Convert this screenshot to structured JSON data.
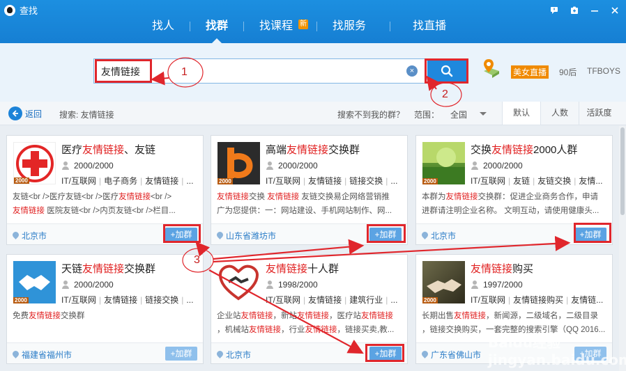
{
  "window": {
    "title": "查找",
    "controls": [
      "feedback-icon",
      "skin-icon",
      "minimize-icon",
      "close-icon"
    ]
  },
  "nav": {
    "items": [
      {
        "label": "找人"
      },
      {
        "label": "找群",
        "active": true
      },
      {
        "label": "找课程",
        "badge": "新"
      },
      {
        "label": "找服务"
      },
      {
        "label": "找直播"
      }
    ]
  },
  "search": {
    "value": "友情链接",
    "clear_icon": "×",
    "hot_live": "美女直播",
    "hot_words": [
      "90后",
      "TFBOYS"
    ]
  },
  "filter": {
    "back_label": "返回",
    "search_label": "搜索: 友情链接",
    "not_found": "搜索不到我的群？",
    "range_label": "范围：",
    "range_value": "全国",
    "sort_tabs": [
      "默认",
      "人数",
      "活跃度"
    ]
  },
  "cards": [
    {
      "name_parts": [
        "医疗",
        "友情链接",
        "、友链"
      ],
      "count": "2000/2000",
      "tags": [
        "IT/互联网",
        "电子商务",
        "友情链接",
        "..."
      ],
      "desc_line1": "友链<br />医疗友链<br />医疗友情链接<br />",
      "desc_line2": "友情链接 医院友链<br />内页友链<br />栏目...",
      "city": "北京市",
      "join": "+加群",
      "img_badge": "2000"
    },
    {
      "name_parts": [
        "高端",
        "友情链接",
        "交换群"
      ],
      "count": "2000/2000",
      "tags": [
        "IT/互联网",
        "友情链接",
        "链接交换",
        "..."
      ],
      "desc_line1": "友情链接交换 友情链接 友链交换易企网络营销推",
      "desc_line2": "广为您提供：一：网站建设、手机网站制作、网...",
      "city": "山东省潍坊市",
      "join": "+加群",
      "img_badge": "2000"
    },
    {
      "name_parts": [
        "交换",
        "友情链接",
        "2000人群"
      ],
      "count": "2000/2000",
      "tags": [
        "IT/互联网",
        "友链",
        "友链交换",
        "友情..."
      ],
      "desc_line1": "本群为友情链接交换群：促进企业商务合作，申请",
      "desc_line2": "进群请注明企业名称。 文明互动，请使用健康头...",
      "city": "北京市",
      "join": "+加群",
      "img_badge": "2000"
    },
    {
      "name_parts": [
        "天链",
        "友情链接",
        "交换群"
      ],
      "count": "2000/2000",
      "tags": [
        "IT/互联网",
        "友情链接",
        "链接交换",
        "..."
      ],
      "desc_line1": "免费友情链接交换群",
      "desc_line2": "",
      "city": "福建省福州市",
      "join": "+加群",
      "img_badge": "2000"
    },
    {
      "name_parts": [
        "",
        "友情链接",
        "十人群"
      ],
      "count": "1998/2000",
      "tags": [
        "IT/互联网",
        "友情链接",
        "建筑行业",
        "..."
      ],
      "desc_line1": "企业站友情链接，新站友情链接，医疗站友情链接",
      "desc_line2": "，机械站友情链接，行业友情链接，链接买卖,教...",
      "city": "北京市",
      "join": "+加群",
      "img_badge": ""
    },
    {
      "name_parts": [
        "",
        "友情链接",
        "购买"
      ],
      "count": "1997/2000",
      "tags": [
        "IT/互联网",
        "友情链接购买",
        "友情链..."
      ],
      "desc_line1": "长期出售友情链接，新闻源，二级域名，二级目录",
      "desc_line2": "，链接交换购买，一套完整的搜索引擎（QQ 2016...",
      "city": "广东省佛山市",
      "join": "+加群",
      "img_badge": "2000"
    }
  ],
  "annotations": {
    "n1": "1",
    "n2": "2",
    "n3": "3",
    "color": "#e0262c"
  },
  "watermark": "Baidu经验 jingyan.baidu.com"
}
